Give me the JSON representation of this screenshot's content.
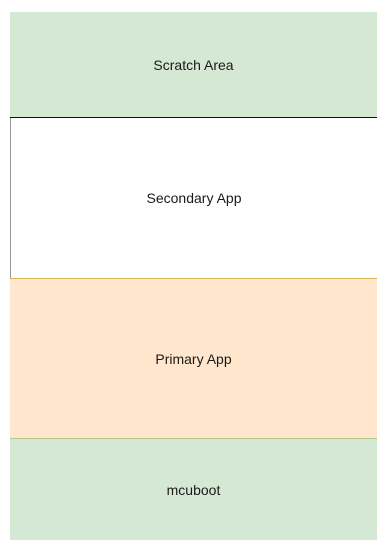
{
  "regions": {
    "scratch": {
      "label": "Scratch Area",
      "fill": "#d5e8d4"
    },
    "secondary": {
      "label": "Secondary App",
      "fill": "#ffffff"
    },
    "primary": {
      "label": "Primary App",
      "fill": "#ffe6cc"
    },
    "mcuboot": {
      "label": "mcuboot",
      "fill": "#d5e8d4"
    }
  }
}
